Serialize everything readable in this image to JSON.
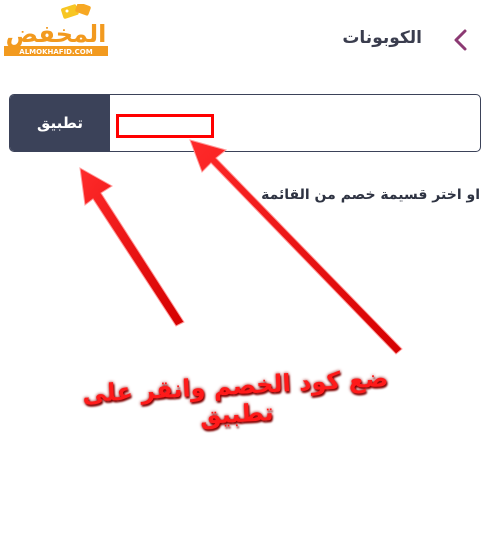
{
  "header": {
    "title": "الكوبونات",
    "back_icon": "chevron-left-icon",
    "accent_color": "#8c3a73"
  },
  "logo": {
    "text_ar": "المخفض",
    "text_en": "ALMOKHAFID.COM",
    "color": "#f29a1f"
  },
  "coupon": {
    "apply_label": "تطبيق",
    "input_value": "",
    "button_color": "#3b4259"
  },
  "choose_text": "او اختر قسيمة خصم من القائمة",
  "annotation": {
    "instruction": "ضع كود الخصم وانقر على تطبيق",
    "color": "#ff0000"
  }
}
